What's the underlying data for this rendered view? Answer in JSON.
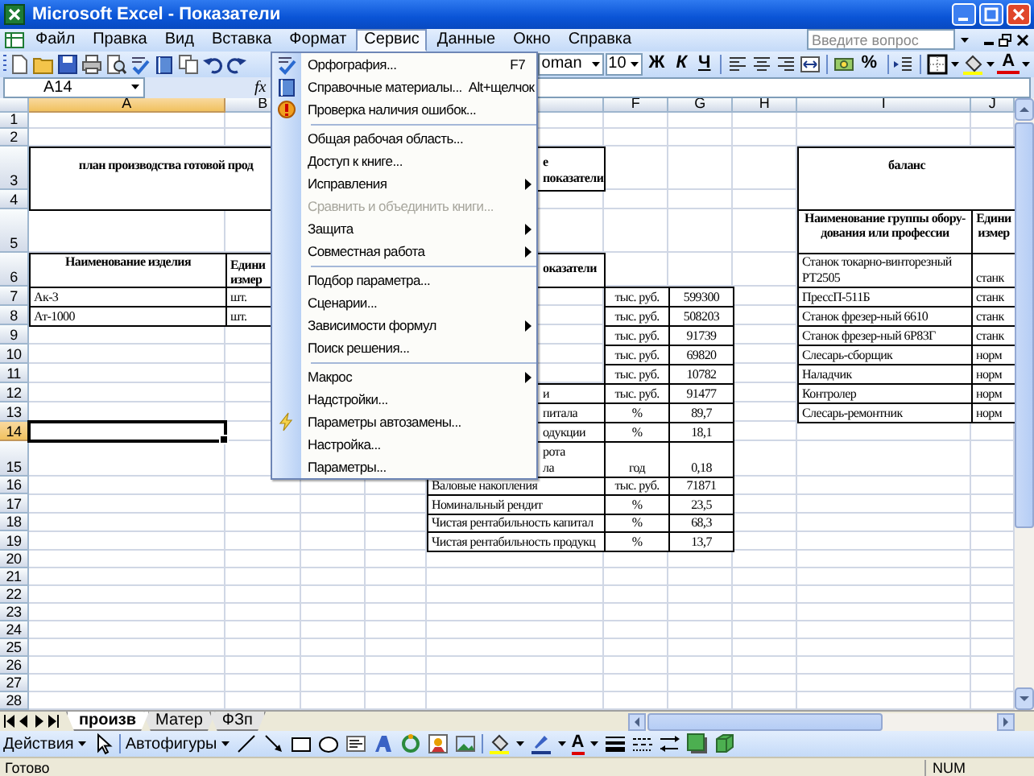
{
  "window": {
    "title": "Microsoft Excel - Показатели"
  },
  "menu_bar": [
    {
      "label": "Файл",
      "selected": false
    },
    {
      "label": "Правка",
      "selected": false
    },
    {
      "label": "Вид",
      "selected": false
    },
    {
      "label": "Вставка",
      "selected": false
    },
    {
      "label": "Формат",
      "selected": false
    },
    {
      "label": "Сервис",
      "selected": true
    },
    {
      "label": "Данные",
      "selected": false
    },
    {
      "label": "Окно",
      "selected": false
    },
    {
      "label": "Справка",
      "selected": false
    }
  ],
  "help_search": {
    "placeholder": "Введите вопрос"
  },
  "toolbar": {
    "font_name": "oman",
    "font_size": "10",
    "bold": "Ж",
    "italic": "К",
    "underline": "Ч",
    "percent": "%",
    "font_color": "A"
  },
  "formula_bar": {
    "name_box": "A14",
    "function_label": "fx"
  },
  "columns": {
    "A": {
      "label": "A",
      "selected": true
    },
    "B": {
      "label": "B",
      "selected": false
    },
    "F": {
      "label": "F",
      "selected": false
    },
    "G": {
      "label": "G",
      "selected": false
    },
    "H": {
      "label": "H",
      "selected": false
    },
    "I": {
      "label": "I",
      "selected": false
    },
    "J": {
      "label": "J",
      "selected": false
    }
  },
  "rows": [
    {
      "number": "1",
      "selected": false
    },
    {
      "number": "2",
      "selected": false
    },
    {
      "number": "3",
      "selected": false,
      "cells": {
        "A": {
          "text": "план производства готовой прод",
          "kind": "title"
        },
        "E": {
          "text": "е показатели",
          "kind": "partial_header"
        },
        "I": {
          "text": "баланс",
          "kind": "title"
        }
      }
    },
    {
      "number": "4",
      "selected": false
    },
    {
      "number": "5",
      "selected": false,
      "cells": {
        "I": {
          "text": "Наименование группы обору-дования или профессии",
          "kind": "header"
        },
        "J": {
          "text": "Едини измер",
          "kind": "header"
        }
      }
    },
    {
      "number": "6",
      "selected": false,
      "cells": {
        "A": {
          "text": "Наименование изделия",
          "kind": "header"
        },
        "B": {
          "text": "Едини измер",
          "kind": "clipped_header"
        },
        "E": {
          "text": "оказатели",
          "kind": "partial_header"
        },
        "I": {
          "text": "Станок токарно-винторезный РТ2505",
          "kind": "wrap"
        },
        "J": {
          "text": "станк",
          "kind": "text"
        }
      }
    },
    {
      "number": "7",
      "selected": false,
      "cells": {
        "A": {
          "text": "Ак-3",
          "kind": "text"
        },
        "B": {
          "text": "шт.",
          "kind": "text"
        },
        "F": {
          "text": "тыс. руб.",
          "kind": "unit"
        },
        "G": {
          "text": "599300",
          "kind": "unit"
        },
        "I": {
          "text": "ПрессП-511Б",
          "kind": "text"
        },
        "J": {
          "text": "станк",
          "kind": "text"
        }
      }
    },
    {
      "number": "8",
      "selected": false,
      "cells": {
        "A": {
          "text": "Ат-1000",
          "kind": "text"
        },
        "B": {
          "text": "шт.",
          "kind": "text"
        },
        "F": {
          "text": "тыс. руб.",
          "kind": "unit"
        },
        "G": {
          "text": "508203",
          "kind": "unit"
        },
        "I": {
          "text": "Станок фрезер-ный 6610",
          "kind": "text"
        },
        "J": {
          "text": "станк",
          "kind": "text"
        }
      }
    },
    {
      "number": "9",
      "selected": false,
      "cells": {
        "F": {
          "text": "тыс. руб.",
          "kind": "unit"
        },
        "G": {
          "text": "91739",
          "kind": "unit"
        },
        "I": {
          "text": "Станок фрезер-ный 6Р83Г",
          "kind": "text"
        },
        "J": {
          "text": "станк",
          "kind": "text"
        }
      }
    },
    {
      "number": "10",
      "selected": false,
      "cells": {
        "F": {
          "text": "тыс. руб.",
          "kind": "unit"
        },
        "G": {
          "text": "69820",
          "kind": "unit"
        },
        "I": {
          "text": "Слесарь-сборщик",
          "kind": "text"
        },
        "J": {
          "text": "норм",
          "kind": "text"
        }
      }
    },
    {
      "number": "11",
      "selected": false,
      "cells": {
        "F": {
          "text": "тыс. руб.",
          "kind": "unit"
        },
        "G": {
          "text": "10782",
          "kind": "unit"
        },
        "I": {
          "text": "Наладчик",
          "kind": "text"
        },
        "J": {
          "text": "норм",
          "kind": "text"
        }
      }
    },
    {
      "number": "12",
      "selected": false,
      "cells": {
        "E": {
          "text": "и",
          "kind": "partial"
        },
        "F": {
          "text": "тыс. руб.",
          "kind": "unit"
        },
        "G": {
          "text": "91477",
          "kind": "unit"
        },
        "I": {
          "text": "Контролер",
          "kind": "text"
        },
        "J": {
          "text": "норм",
          "kind": "text"
        }
      }
    },
    {
      "number": "13",
      "selected": false,
      "cells": {
        "E": {
          "text": "питала",
          "kind": "partial"
        },
        "F": {
          "text": "%",
          "kind": "unit"
        },
        "G": {
          "text": "89,7",
          "kind": "unit"
        },
        "I": {
          "text": "Слесарь-ремонтник",
          "kind": "text"
        },
        "J": {
          "text": "норм",
          "kind": "text"
        }
      }
    },
    {
      "number": "14",
      "selected": true,
      "cells": {
        "E": {
          "text": "одукции",
          "kind": "partial"
        },
        "F": {
          "text": "%",
          "kind": "unit"
        },
        "G": {
          "text": "18,1",
          "kind": "unit"
        }
      }
    },
    {
      "number": "15",
      "selected": false,
      "cells": {
        "E": {
          "text": "рота\nла",
          "kind": "partial"
        },
        "F": {
          "text": "год",
          "kind": "unit"
        },
        "G": {
          "text": "0,18",
          "kind": "unit"
        }
      }
    },
    {
      "number": "16",
      "selected": false,
      "cells": {
        "E": {
          "text": "Валовые накопления",
          "kind": "text"
        },
        "F": {
          "text": "тыс. руб.",
          "kind": "unit"
        },
        "G": {
          "text": "71871",
          "kind": "unit"
        }
      }
    },
    {
      "number": "17",
      "selected": false,
      "cells": {
        "E": {
          "text": "Номинальный рендит",
          "kind": "text"
        },
        "F": {
          "text": "%",
          "kind": "unit"
        },
        "G": {
          "text": "23,5",
          "kind": "unit"
        }
      }
    },
    {
      "number": "18",
      "selected": false,
      "cells": {
        "E": {
          "text": "Чистая рентабильность капитал",
          "kind": "text"
        },
        "F": {
          "text": "%",
          "kind": "unit"
        },
        "G": {
          "text": "68,3",
          "kind": "unit"
        }
      }
    },
    {
      "number": "19",
      "selected": false,
      "cells": {
        "E": {
          "text": "Чистая рентабильность продукц",
          "kind": "text"
        },
        "F": {
          "text": "%",
          "kind": "unit"
        },
        "G": {
          "text": "13,7",
          "kind": "unit"
        }
      }
    },
    {
      "number": "20",
      "selected": false
    },
    {
      "number": "21",
      "selected": false
    },
    {
      "number": "22",
      "selected": false
    },
    {
      "number": "23",
      "selected": false
    },
    {
      "number": "24",
      "selected": false
    },
    {
      "number": "25",
      "selected": false
    },
    {
      "number": "26",
      "selected": false
    },
    {
      "number": "27",
      "selected": false
    },
    {
      "number": "28",
      "selected": false
    }
  ],
  "menu": {
    "items": [
      {
        "label": "Орфография...",
        "shortcut": "F7",
        "icon": true,
        "submenu": false,
        "disabled": false,
        "separator_before": false
      },
      {
        "label": "Справочные материалы...",
        "shortcut": "Alt+щелчок",
        "icon": true,
        "submenu": false,
        "disabled": false,
        "separator_before": false
      },
      {
        "label": "Проверка наличия ошибок...",
        "icon": true,
        "submenu": false,
        "disabled": false,
        "separator_before": false
      },
      {
        "label": "Общая рабочая область...",
        "icon": false,
        "submenu": false,
        "disabled": false,
        "separator_before": true
      },
      {
        "label": "Доступ к книге...",
        "icon": false,
        "submenu": false,
        "disabled": false,
        "separator_before": false
      },
      {
        "label": "Исправления",
        "icon": false,
        "submenu": true,
        "disabled": false,
        "separator_before": false
      },
      {
        "label": "Сравнить и объединить книги...",
        "icon": false,
        "submenu": false,
        "disabled": true,
        "separator_before": false
      },
      {
        "label": "Защита",
        "icon": false,
        "submenu": true,
        "disabled": false,
        "separator_before": false
      },
      {
        "label": "Совместная работа",
        "icon": false,
        "submenu": true,
        "disabled": false,
        "separator_before": false
      },
      {
        "label": "Подбор параметра...",
        "icon": false,
        "submenu": false,
        "disabled": false,
        "separator_before": true
      },
      {
        "label": "Сценарии...",
        "icon": false,
        "submenu": false,
        "disabled": false,
        "separator_before": false
      },
      {
        "label": "Зависимости формул",
        "icon": false,
        "submenu": true,
        "disabled": false,
        "separator_before": false
      },
      {
        "label": "Поиск решения...",
        "icon": false,
        "submenu": false,
        "disabled": false,
        "separator_before": false
      },
      {
        "label": "Макрос",
        "icon": false,
        "submenu": true,
        "disabled": false,
        "separator_before": true
      },
      {
        "label": "Надстройки...",
        "icon": false,
        "submenu": false,
        "disabled": false,
        "separator_before": false
      },
      {
        "label": "Параметры автозамены...",
        "icon": true,
        "submenu": false,
        "disabled": false,
        "separator_before": false
      },
      {
        "label": "Настройка...",
        "icon": false,
        "submenu": false,
        "disabled": false,
        "separator_before": false
      },
      {
        "label": "Параметры...",
        "icon": false,
        "submenu": false,
        "disabled": false,
        "separator_before": false
      }
    ]
  },
  "sheet_tabs": [
    {
      "label": "произв",
      "selected": true
    },
    {
      "label": "Матер",
      "selected": false
    },
    {
      "label": "ФЗп",
      "selected": false
    }
  ],
  "drawing_toolbar": {
    "actions": "Действия",
    "autoshapes": "Автофигуры",
    "font_color": "A"
  },
  "status_bar": {
    "text": "Готово",
    "num_lock": "NUM"
  }
}
